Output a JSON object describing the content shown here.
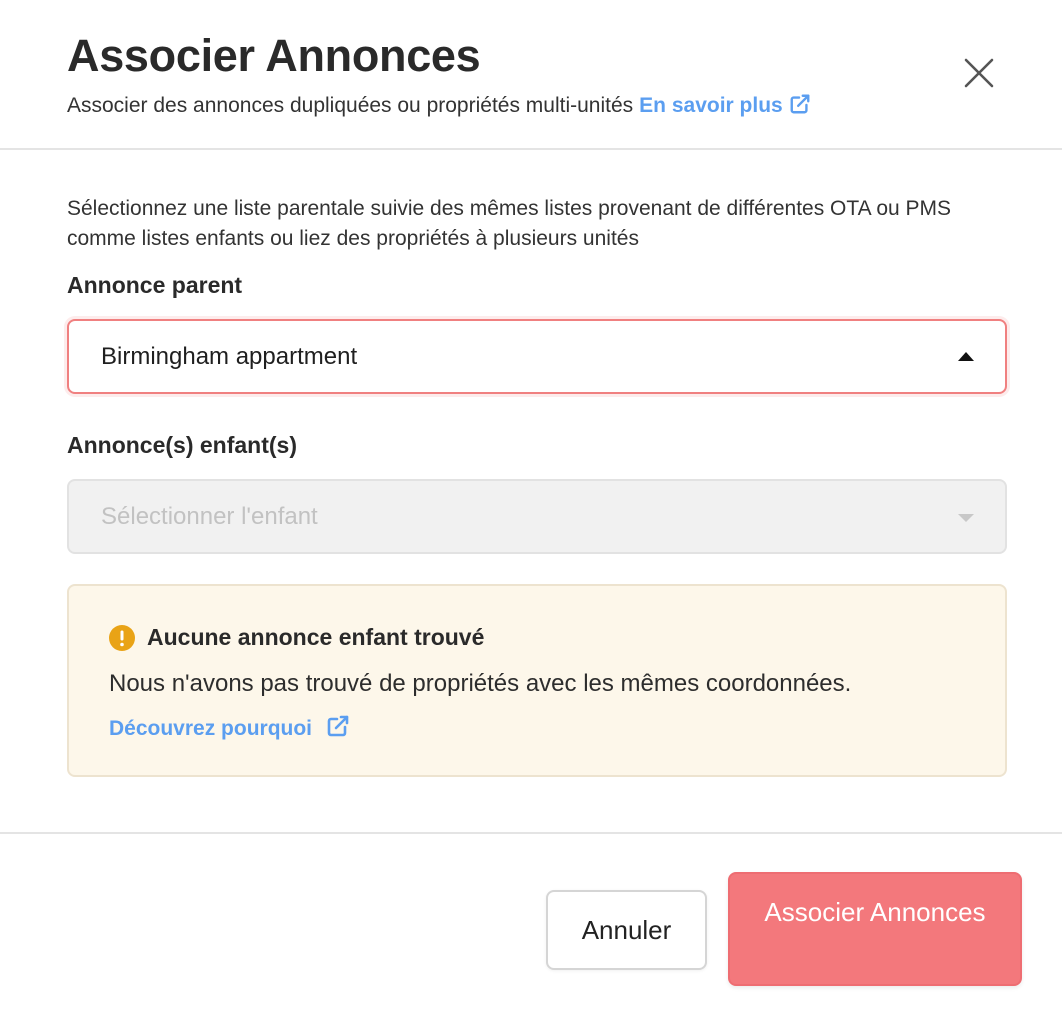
{
  "header": {
    "title": "Associer Annonces",
    "subtitle": "Associer des annonces dupliquées ou propriétés multi-unités",
    "learn_more": "En savoir plus",
    "close_icon": "close-icon"
  },
  "form": {
    "description": "Sélectionnez une liste parentale suivie des mêmes listes provenant de différentes OTA ou PMS comme listes enfants ou liez des propriétés à plusieurs unités",
    "parent_label": "Annonce parent",
    "parent_value": "Birmingham appartment",
    "child_label": "Annonce(s) enfant(s)",
    "child_placeholder": "Sélectionner l'enfant"
  },
  "alert": {
    "icon": "warning-icon",
    "title": "Aucune annonce enfant trouvé",
    "message": "Nous n'avons pas trouvé de propriétés avec les mêmes coordonnées.",
    "link": "Découvrez pourquoi"
  },
  "footer": {
    "cancel_label": "Annuler",
    "submit_label": "Associer Annonces"
  },
  "colors": {
    "accent": "#f3787c",
    "link": "#5b9ef0",
    "warning": "#e9a316",
    "alert_bg": "#fdf7ea"
  }
}
